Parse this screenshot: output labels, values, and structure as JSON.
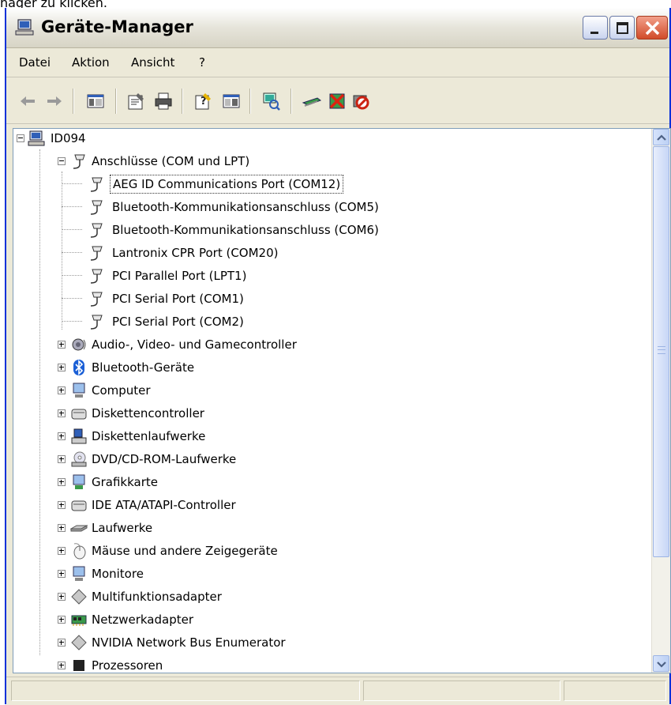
{
  "caption_fragment": "nager zu klicken.",
  "window": {
    "title": "Geräte-Manager",
    "title_icon": "device-manager-icon"
  },
  "menu": {
    "items": [
      {
        "label": "Datei"
      },
      {
        "label": "Aktion"
      },
      {
        "label": "Ansicht"
      },
      {
        "label": "?"
      }
    ]
  },
  "toolbar": {
    "buttons": [
      "back-arrow-icon",
      "forward-arrow-icon",
      "show-hide-tree-icon",
      "properties-icon",
      "print-icon",
      "help-icon",
      "console-icon",
      "scan-hardware-icon",
      "update-driver-icon",
      "uninstall-icon",
      "disable-icon"
    ]
  },
  "tree": {
    "root": {
      "label": "ID094",
      "icon": "computer-icon"
    },
    "rows": [
      {
        "label": "Anschlüsse (COM und LPT)",
        "icon": "port-connector-icon"
      },
      {
        "label": "AEG ID Communications Port (COM12)",
        "icon": "port-connector-icon",
        "selected": true
      },
      {
        "label": "Bluetooth-Kommunikationsanschluss (COM5)",
        "icon": "port-connector-icon"
      },
      {
        "label": "Bluetooth-Kommunikationsanschluss (COM6)",
        "icon": "port-connector-icon"
      },
      {
        "label": "Lantronix CPR Port (COM20)",
        "icon": "port-connector-icon"
      },
      {
        "label": "PCI Parallel Port (LPT1)",
        "icon": "port-connector-icon"
      },
      {
        "label": "PCI Serial Port (COM1)",
        "icon": "port-connector-icon"
      },
      {
        "label": "PCI Serial Port (COM2)",
        "icon": "port-connector-icon"
      },
      {
        "label": "Audio-, Video- und Gamecontroller",
        "icon": "speaker-icon"
      },
      {
        "label": "Bluetooth-Geräte",
        "icon": "bluetooth-icon"
      },
      {
        "label": "Computer",
        "icon": "monitor-icon"
      },
      {
        "label": "Diskettencontroller",
        "icon": "controller-icon"
      },
      {
        "label": "Diskettenlaufwerke",
        "icon": "floppy-drive-icon"
      },
      {
        "label": "DVD/CD-ROM-Laufwerke",
        "icon": "cd-drive-icon"
      },
      {
        "label": "Grafikkarte",
        "icon": "display-adapter-icon"
      },
      {
        "label": "IDE ATA/ATAPI-Controller",
        "icon": "controller-icon"
      },
      {
        "label": "Laufwerke",
        "icon": "disk-drive-icon"
      },
      {
        "label": "Mäuse und andere Zeigegeräte",
        "icon": "mouse-icon"
      },
      {
        "label": "Monitore",
        "icon": "monitor-icon"
      },
      {
        "label": "Multifunktionsadapter",
        "icon": "diamond-device-icon"
      },
      {
        "label": "Netzwerkadapter",
        "icon": "network-card-icon"
      },
      {
        "label": "NVIDIA Network Bus Enumerator",
        "icon": "diamond-device-icon"
      },
      {
        "label": "Prozessoren",
        "icon": "processor-icon"
      }
    ]
  },
  "colors": {
    "window_border": "#0831d9",
    "close_button": "#d14b2a",
    "chrome_background": "#ece9d8",
    "bluetooth": "#1a5fd6"
  }
}
